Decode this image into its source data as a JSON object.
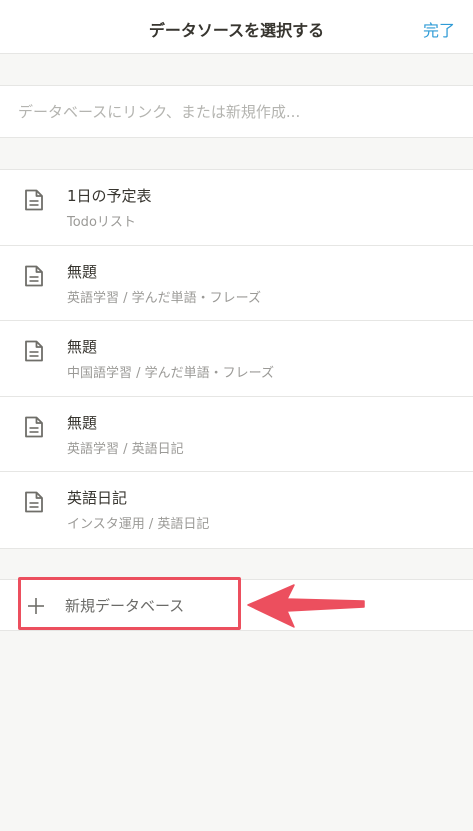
{
  "header": {
    "title": "データソースを選択する",
    "done_label": "完了"
  },
  "search": {
    "placeholder": "データベースにリンク、または新規作成..."
  },
  "databases": [
    {
      "title": "1日の予定表",
      "subtitle": "Todoリスト",
      "icon": "page-icon"
    },
    {
      "title": "無題",
      "subtitle": "英語学習 / 学んだ単語・フレーズ",
      "icon": "page-icon"
    },
    {
      "title": "無題",
      "subtitle": "中国語学習 / 学んだ単語・フレーズ",
      "icon": "page-icon"
    },
    {
      "title": "無題",
      "subtitle": "英語学習 / 英語日記",
      "icon": "page-icon"
    },
    {
      "title": "英語日記",
      "subtitle": "インスタ運用 / 英語日記",
      "icon": "page-icon"
    }
  ],
  "new_database": {
    "label": "新規データベース",
    "icon": "plus-icon"
  },
  "annotation": {
    "highlight_color": "#ec4f5e",
    "arrow_color": "#ec4f5e"
  },
  "colors": {
    "accent": "#2f9bd6",
    "background": "#f7f7f5"
  }
}
